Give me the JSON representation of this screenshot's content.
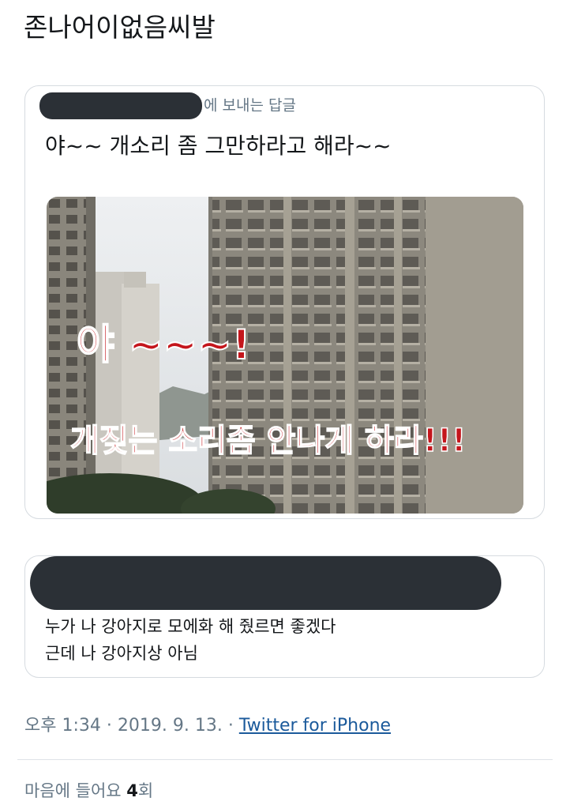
{
  "tweet": {
    "text": "존나어이없음씨발"
  },
  "quoted_tweet": {
    "reply_context_suffix": "에 보내는 답글",
    "text": "야~~ 개소리 좀 그만하라고 해라~~",
    "image": {
      "caption_line1": "야 ~~~!",
      "caption_line2": "개짖는 소리좀 안나게 하라!!!",
      "caption_color": "#c4161c"
    }
  },
  "quoted_tweet_2": {
    "line1": "누가 나 강아지로 모에화 해 줬르면 좋겠다",
    "line2": "근데 나 강아지상 아님"
  },
  "meta": {
    "time": "오후 1:34",
    "sep1": " · ",
    "date": "2019. 9. 13.",
    "sep2": " · ",
    "source": "Twitter for iPhone"
  },
  "likes": {
    "label": "마음에 들어요",
    "count": "4",
    "unit": "회"
  },
  "colors": {
    "secondary_text": "#657786",
    "link": "#1b5a9b",
    "border": "#d6dbe0",
    "redaction": "#2b3036"
  }
}
